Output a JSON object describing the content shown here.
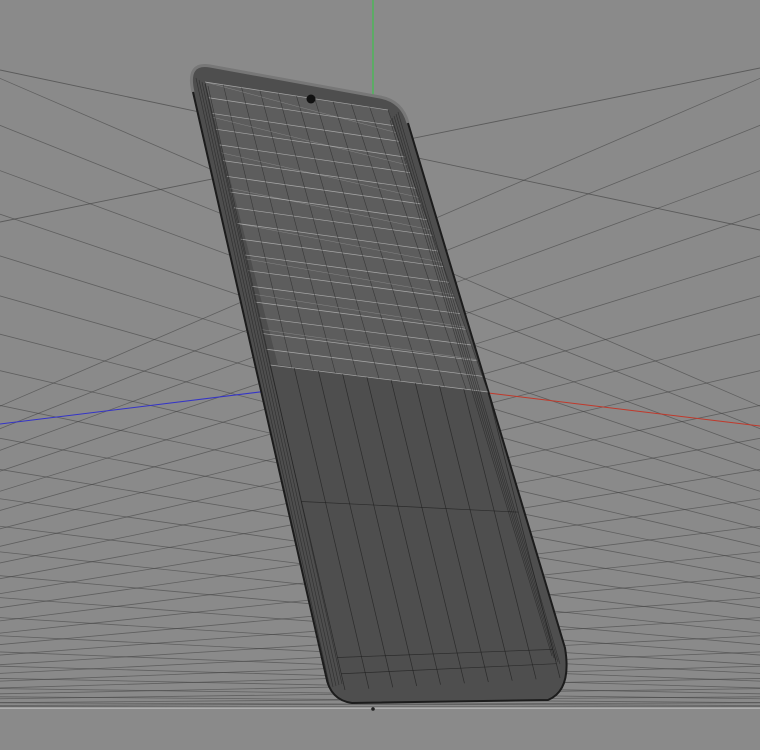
{
  "viewport": {
    "background_color": "#8a8a8a",
    "grid_color": "#3c3c3c",
    "horizon_color": "#c4c4c4",
    "axis_colors": {
      "x": "#c0392b",
      "y": "#2ecc40",
      "z": "#3434c8"
    }
  },
  "model": {
    "name": "smartphone",
    "display_mode": "wireframe",
    "body_color": "#4e4e4e",
    "screen_color": "#6a6a6a",
    "wire_light_color": "#d2d2d2",
    "wire_dark_color": "#1c1c1c"
  }
}
